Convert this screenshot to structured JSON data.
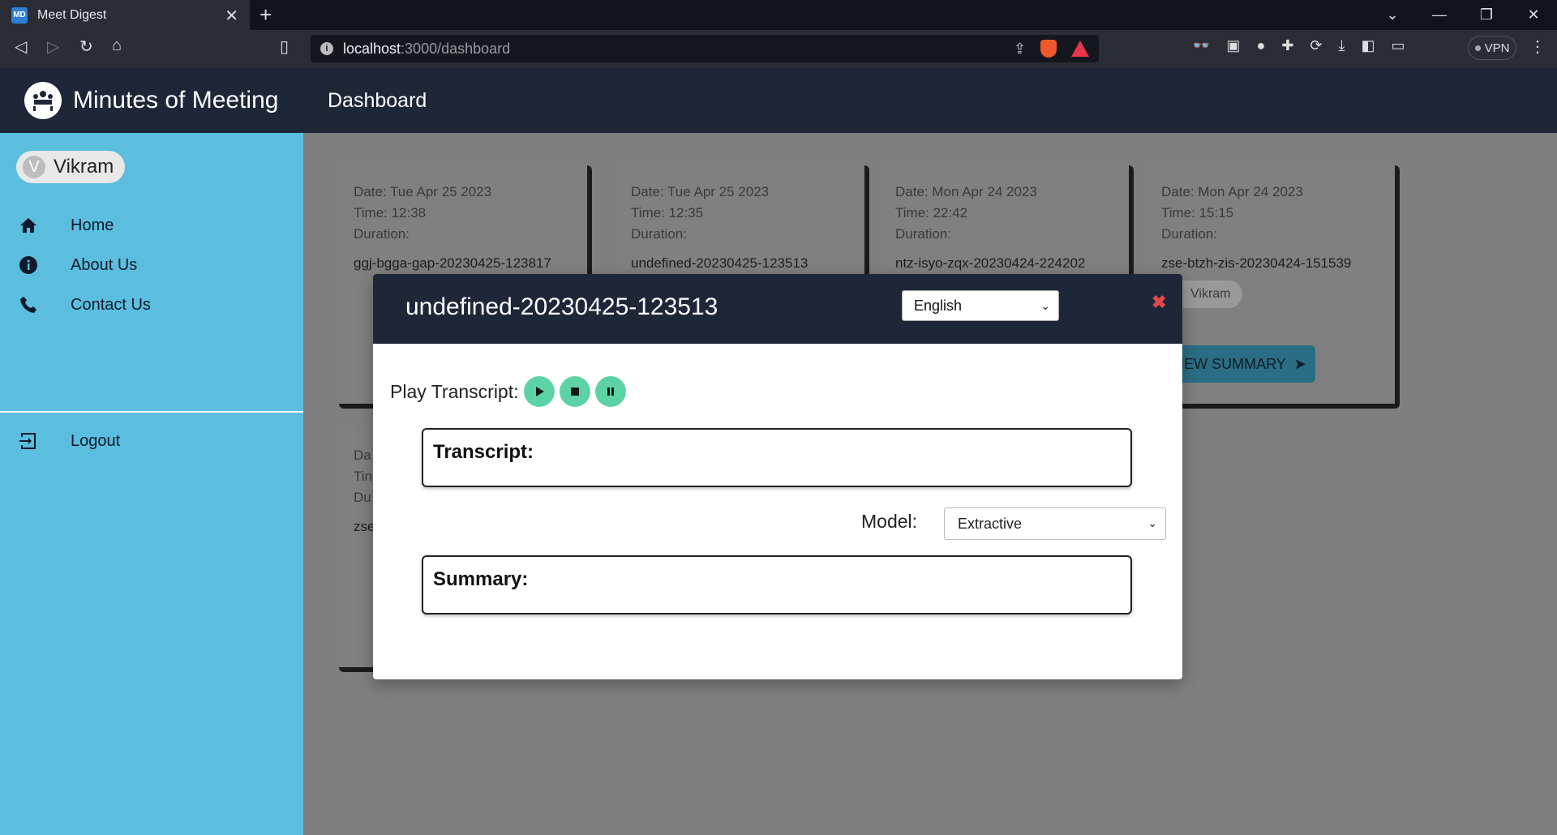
{
  "browser": {
    "tab_title": "Meet Digest",
    "favicon_text": "MD",
    "url_host": "localhost",
    "url_path": ":3000/dashboard",
    "vpn_label": "VPN",
    "brave_badge": "1"
  },
  "app": {
    "brand_title": "Minutes of Meeting",
    "page_title": "Dashboard"
  },
  "sidebar": {
    "user_initial": "V",
    "user_name": "Vikram",
    "items": [
      {
        "label": "Home",
        "icon": "home-icon"
      },
      {
        "label": "About Us",
        "icon": "info-icon"
      },
      {
        "label": "Contact Us",
        "icon": "phone-icon"
      }
    ],
    "logout_label": "Logout"
  },
  "cards": [
    {
      "date": "Date: Tue Apr 25 2023",
      "time": "Time: 12:38",
      "duration": "Duration:",
      "name": "ggj-bgga-gap-20230425-123817"
    },
    {
      "date": "Date: Tue Apr 25 2023",
      "time": "Time: 12:35",
      "duration": "Duration:",
      "name": "undefined-20230425-123513"
    },
    {
      "date": "Date: Mon Apr 24 2023",
      "time": "Time: 22:42",
      "duration": "Duration:",
      "name": "ntz-isyo-zqx-20230424-224202"
    },
    {
      "date": "Date: Mon Apr 24 2023",
      "time": "Time: 15:15",
      "duration": "Duration:",
      "name": "zse-btzh-zis-20230424-151539",
      "owner": "Vikram",
      "button": "VIEW SUMMARY"
    },
    {
      "date": "Da",
      "time": "Tin",
      "duration": "Du",
      "name": "zse"
    }
  ],
  "modal": {
    "title": "undefined-20230425-123513",
    "language": "English",
    "play_label": "Play Transcript:",
    "transcript_label": "Transcript:",
    "model_label": "Model:",
    "model_value": "Extractive",
    "summary_label": "Summary:"
  }
}
